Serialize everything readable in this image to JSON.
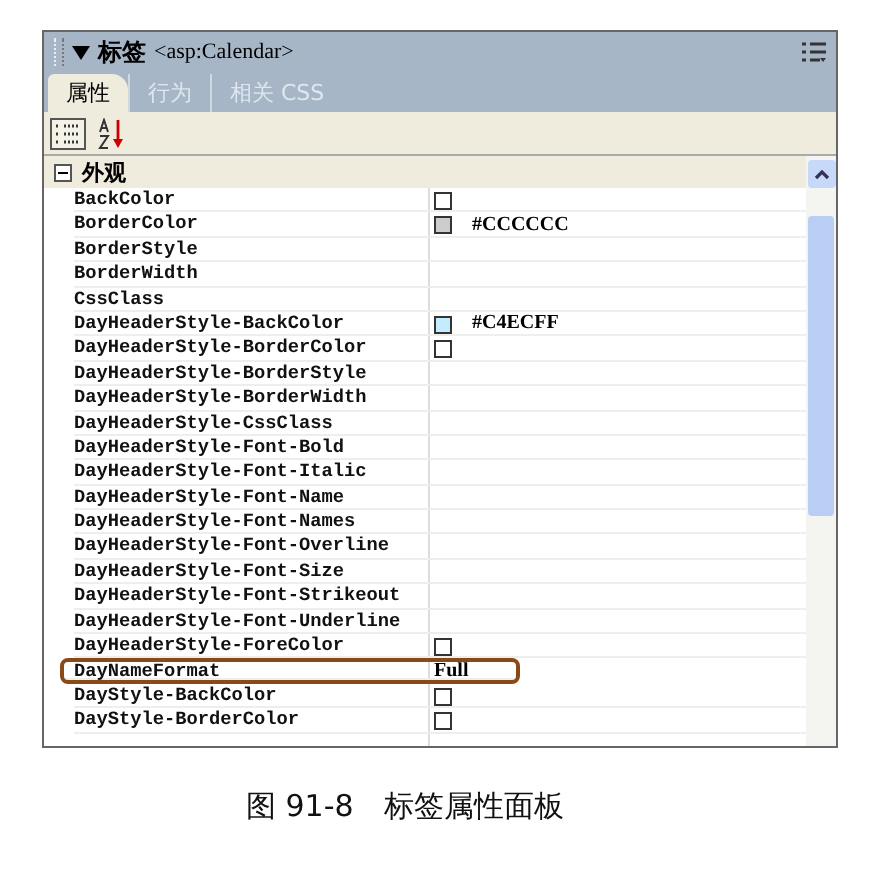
{
  "panel": {
    "title": "标签",
    "subtitle": "<asp:Calendar>"
  },
  "tabs": [
    {
      "label": "属性",
      "selected": true
    },
    {
      "label": "行为",
      "selected": false
    },
    {
      "label": "相关 CSS",
      "selected": false
    }
  ],
  "category": {
    "label": "外观",
    "expanded": true
  },
  "rows": [
    {
      "name": "BackColor",
      "kind": "color"
    },
    {
      "name": "BorderColor",
      "kind": "color",
      "color": "#cccccc",
      "value": "#CCCCCC"
    },
    {
      "name": "BorderStyle",
      "kind": "text"
    },
    {
      "name": "BorderWidth",
      "kind": "text"
    },
    {
      "name": "CssClass",
      "kind": "text"
    },
    {
      "name": "DayHeaderStyle-BackColor",
      "kind": "color",
      "color": "#c4ecff",
      "value": "#C4ECFF"
    },
    {
      "name": "DayHeaderStyle-BorderColor",
      "kind": "color"
    },
    {
      "name": "DayHeaderStyle-BorderStyle",
      "kind": "text"
    },
    {
      "name": "DayHeaderStyle-BorderWidth",
      "kind": "text"
    },
    {
      "name": "DayHeaderStyle-CssClass",
      "kind": "text"
    },
    {
      "name": "DayHeaderStyle-Font-Bold",
      "kind": "text"
    },
    {
      "name": "DayHeaderStyle-Font-Italic",
      "kind": "text"
    },
    {
      "name": "DayHeaderStyle-Font-Name",
      "kind": "text"
    },
    {
      "name": "DayHeaderStyle-Font-Names",
      "kind": "text"
    },
    {
      "name": "DayHeaderStyle-Font-Overline",
      "kind": "text"
    },
    {
      "name": "DayHeaderStyle-Font-Size",
      "kind": "text"
    },
    {
      "name": "DayHeaderStyle-Font-Strikeout",
      "kind": "text"
    },
    {
      "name": "DayHeaderStyle-Font-Underline",
      "kind": "text"
    },
    {
      "name": "DayHeaderStyle-ForeColor",
      "kind": "color"
    },
    {
      "name": "DayNameFormat",
      "kind": "text",
      "value": "Full",
      "highlighted": true
    },
    {
      "name": "DayStyle-BackColor",
      "kind": "color"
    },
    {
      "name": "DayStyle-BorderColor",
      "kind": "color"
    }
  ],
  "caption": {
    "number": "图 91-8",
    "text": "标签属性面板"
  }
}
